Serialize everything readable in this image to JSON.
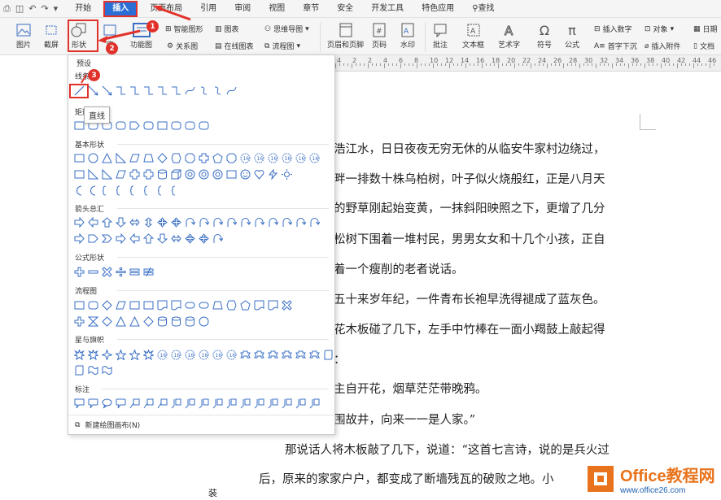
{
  "menubar": {
    "items": [
      {
        "label": "开始",
        "active": false
      },
      {
        "label": "插入",
        "active": true
      },
      {
        "label": "页面布局",
        "active": false
      },
      {
        "label": "引用",
        "active": false
      },
      {
        "label": "审阅",
        "active": false
      },
      {
        "label": "视图",
        "active": false
      },
      {
        "label": "章节",
        "active": false
      },
      {
        "label": "安全",
        "active": false
      },
      {
        "label": "开发工具",
        "active": false
      },
      {
        "label": "特色应用",
        "active": false
      }
    ],
    "search_label": "查找"
  },
  "ribbon": {
    "image_label": "图片",
    "screenshot_label": "截屏",
    "shape_label": "形状",
    "library_label": "库",
    "function_chart_label": "功能图",
    "smart_shape_label": "智能图形",
    "chart_label": "图表",
    "mind_map_label": "思维导图",
    "relation_chart_label": "关系图",
    "online_chart_label": "在线图表",
    "flowchart_label": "流程图",
    "header_footer_label": "页眉和页脚",
    "page_number_label": "页码",
    "watermark_label": "水印",
    "comment_label": "批注",
    "textbox_label": "文本框",
    "art_text_label": "艺术字",
    "symbol_label": "符号",
    "formula_label": "公式",
    "insert_number_label": "插入数字",
    "object_label": "对象",
    "drop_cap_label": "首字下沉",
    "attachment_label": "插入附件",
    "date_label": "日期",
    "doc_label": "文档"
  },
  "panel": {
    "preset_label": "预设",
    "categories": [
      {
        "label": "线条"
      },
      {
        "label": "矩形"
      },
      {
        "label": "基本形状"
      },
      {
        "label": "箭头总汇"
      },
      {
        "label": "公式形状"
      },
      {
        "label": "流程图"
      },
      {
        "label": "星与旗帜"
      },
      {
        "label": "标注"
      }
    ],
    "tooltip": "直线",
    "footer_label": "新建绘图画布(N)"
  },
  "ruler": {
    "numbers": [
      "4",
      "2",
      "2",
      "4",
      "6",
      "8",
      "10",
      "12",
      "14",
      "16",
      "18",
      "20",
      "22",
      "24",
      "26",
      "28",
      "30",
      "32",
      "34",
      "36",
      "38",
      "40",
      "42",
      "44",
      "46"
    ]
  },
  "document": {
    "lines": [
      "浩江水，日日夜夜无穷无休的从临安牛家村边绕过，",
      "畔一排数十株乌柏树，叶子似火烧般红，正是八月天",
      "的野草刚起始变黄，一抹斜阳映照之下，更增了几分",
      "松树下围着一堆村民，男男女女和十几个小孩，正自",
      "着一个瘦削的老者说话。",
      "五十来岁年纪，一件青布长袍早洗得褪成了蓝灰色。",
      "花木板碰了几下，左手中竹棒在一面小羯鼓上敲起得",
      "：",
      "主自开花，烟草茫茫带晚鸦。",
      "围故井，向来一一是人家。”",
      "那说话人将木板敲了几下，说道：“这首七言诗，说的是兵火过",
      "后，原来的家家户户，都变成了断墙残瓦的破败之地。小"
    ],
    "margin_char": "装"
  },
  "annotations": {
    "badge1": "1",
    "badge2": "2",
    "badge3": "3"
  },
  "watermark": {
    "title": "Office教程网",
    "url": "www.office26.com"
  },
  "colors": {
    "accent": "#2b6fd6",
    "highlight": "#e0322a",
    "shape_stroke": "#3a6fc4",
    "watermark_orange": "#e8731c"
  }
}
